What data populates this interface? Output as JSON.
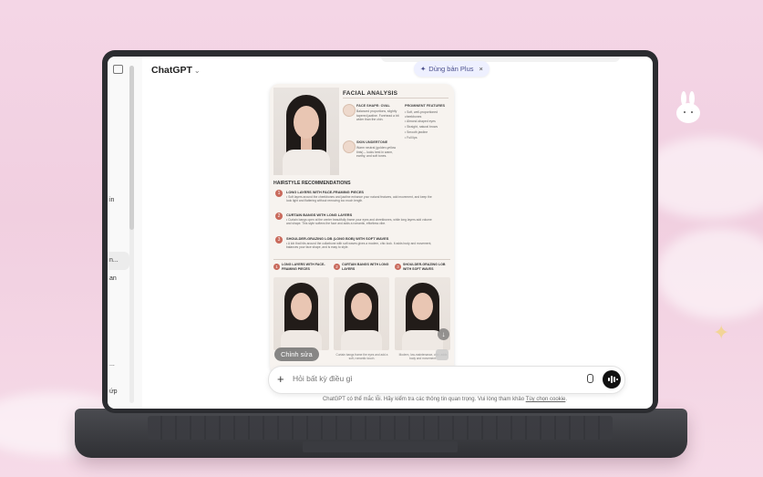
{
  "app": {
    "title": "ChatGPT",
    "title_chevron": "⌄",
    "upgrade_pill": {
      "icon": "✦",
      "label": "Dùng bản Plus",
      "close": "×"
    }
  },
  "sidebar": {
    "fragments": [
      "in",
      "n...",
      "an",
      "...",
      "ứp"
    ]
  },
  "poster": {
    "facial_analysis": {
      "title": "FACIAL ANALYSIS",
      "face_shape": {
        "heading": "FACE SHAPE: OVAL",
        "text": "Balanced proportions, slightly tapered jawline. Forehead a bit wider than the chin."
      },
      "skin_undertone": {
        "heading": "SKIN UNDERTONE",
        "text": "Warm neutral (golden-yellow tints) – looks best in warm, earthy, and soft tones."
      },
      "prominent_features": {
        "heading": "PROMINENT FEATURES",
        "items": [
          "• Soft, well-proportioned cheekbones",
          "• Almond-shaped eyes",
          "• Straight, natural brows",
          "• Smooth jawline",
          "• Full lips"
        ]
      }
    },
    "recommendations": {
      "title": "HAIRSTYLE RECOMMENDATIONS",
      "items": [
        {
          "num": "1",
          "heading": "LONG LAYERS WITH FACE-FRAMING PIECES",
          "text": "• Soft layers around the cheekbones and jawline enhance your natural features, add movement, and keep the look light and flattering without removing too much length."
        },
        {
          "num": "2",
          "heading": "CURTAIN BANGS WITH LONG LAYERS",
          "text": "• Curtain bangs open at the center beautifully frame your eyes and cheekbones, while long layers add volume and shape. This style softens the face and adds a romantic, effortless vibe."
        },
        {
          "num": "3",
          "heading": "SHOULDER-GRAZING LOB (LONG BOB) WITH SOFT WAVES",
          "text": "• A lob that hits around the collarbone with soft waves gives a modern, chic look. It adds body and movement, balances your face shape, and is easy to style."
        }
      ]
    },
    "cards": [
      {
        "num": "1",
        "label": "LONG LAYERS WITH FACE-FRAMING PIECES",
        "caption": ""
      },
      {
        "num": "2",
        "label": "CURTAIN BANGS WITH LONG LAYERS",
        "caption": "Curtain bangs frame the eyes and add a soft, romantic touch."
      },
      {
        "num": "3",
        "label": "SHOULDER-GRAZING LOB WITH SOFT WAVES",
        "caption": "Modern, low-maintenance, chic; adds body and movement."
      }
    ],
    "edit_chip": "Chỉnh sửa",
    "download_icon": "↓"
  },
  "composer": {
    "plus": "+",
    "placeholder": "Hỏi bất kỳ điều gì"
  },
  "disclaimer": {
    "text": "ChatGPT có thể mắc lỗi. Hãy kiểm tra các thông tin quan trọng. Vui lòng tham khảo ",
    "link": "Tùy chọn cookie",
    "end": "."
  },
  "colors": {
    "accent": "#c9695b",
    "pill_bg": "#eef0ff",
    "laptop": "#2b2c30"
  }
}
